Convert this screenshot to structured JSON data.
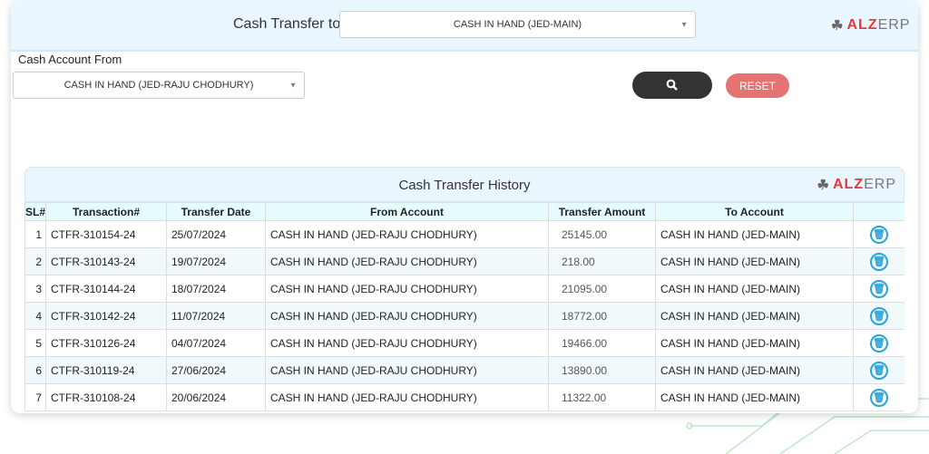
{
  "header": {
    "title": "Cash Transfer to",
    "transfer_to": "CASH IN HAND (JED-MAIN)"
  },
  "logo": {
    "a": "ALZ",
    "b": "ERP"
  },
  "filter": {
    "label": "Cash Account From",
    "account_from": "CASH IN HAND (JED-RAJU CHODHURY)",
    "search_icon": "search-icon",
    "reset_label": "RESET"
  },
  "colors": {
    "accent": "#29a3d8",
    "reset": "#e57373",
    "search": "#333333"
  },
  "history": {
    "title": "Cash Transfer History",
    "columns": [
      "SL#",
      "Transaction#",
      "Transfer Date",
      "From Account",
      "Transfer Amount",
      "To Account",
      ""
    ],
    "rows": [
      {
        "sl": "1",
        "txn": "CTFR-310154-24",
        "date": "25/07/2024",
        "from": "CASH IN HAND (JED-RAJU CHODHURY)",
        "amount": "25145.00",
        "to": "CASH IN HAND (JED-MAIN)"
      },
      {
        "sl": "2",
        "txn": "CTFR-310143-24",
        "date": "19/07/2024",
        "from": "CASH IN HAND (JED-RAJU CHODHURY)",
        "amount": "218.00",
        "to": "CASH IN HAND (JED-MAIN)"
      },
      {
        "sl": "3",
        "txn": "CTFR-310144-24",
        "date": "18/07/2024",
        "from": "CASH IN HAND (JED-RAJU CHODHURY)",
        "amount": "21095.00",
        "to": "CASH IN HAND (JED-MAIN)"
      },
      {
        "sl": "4",
        "txn": "CTFR-310142-24",
        "date": "11/07/2024",
        "from": "CASH IN HAND (JED-RAJU CHODHURY)",
        "amount": "18772.00",
        "to": "CASH IN HAND (JED-MAIN)"
      },
      {
        "sl": "5",
        "txn": "CTFR-310126-24",
        "date": "04/07/2024",
        "from": "CASH IN HAND (JED-RAJU CHODHURY)",
        "amount": "19466.00",
        "to": "CASH IN HAND (JED-MAIN)"
      },
      {
        "sl": "6",
        "txn": "CTFR-310119-24",
        "date": "27/06/2024",
        "from": "CASH IN HAND (JED-RAJU CHODHURY)",
        "amount": "13890.00",
        "to": "CASH IN HAND (JED-MAIN)"
      },
      {
        "sl": "7",
        "txn": "CTFR-310108-24",
        "date": "20/06/2024",
        "from": "CASH IN HAND (JED-RAJU CHODHURY)",
        "amount": "11322.00",
        "to": "CASH IN HAND (JED-MAIN)"
      }
    ]
  }
}
